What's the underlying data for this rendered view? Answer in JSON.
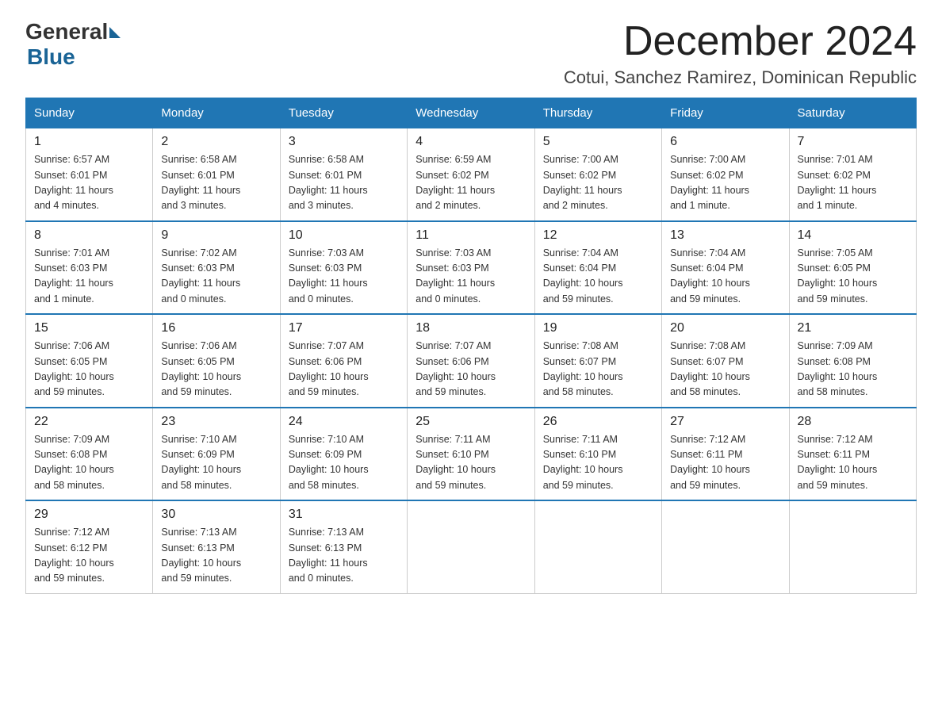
{
  "logo": {
    "general": "General",
    "blue": "Blue"
  },
  "header": {
    "month": "December 2024",
    "location": "Cotui, Sanchez Ramirez, Dominican Republic"
  },
  "days_of_week": [
    "Sunday",
    "Monday",
    "Tuesday",
    "Wednesday",
    "Thursday",
    "Friday",
    "Saturday"
  ],
  "weeks": [
    [
      {
        "day": "1",
        "sunrise": "6:57 AM",
        "sunset": "6:01 PM",
        "daylight": "11 hours and 4 minutes."
      },
      {
        "day": "2",
        "sunrise": "6:58 AM",
        "sunset": "6:01 PM",
        "daylight": "11 hours and 3 minutes."
      },
      {
        "day": "3",
        "sunrise": "6:58 AM",
        "sunset": "6:01 PM",
        "daylight": "11 hours and 3 minutes."
      },
      {
        "day": "4",
        "sunrise": "6:59 AM",
        "sunset": "6:02 PM",
        "daylight": "11 hours and 2 minutes."
      },
      {
        "day": "5",
        "sunrise": "7:00 AM",
        "sunset": "6:02 PM",
        "daylight": "11 hours and 2 minutes."
      },
      {
        "day": "6",
        "sunrise": "7:00 AM",
        "sunset": "6:02 PM",
        "daylight": "11 hours and 1 minute."
      },
      {
        "day": "7",
        "sunrise": "7:01 AM",
        "sunset": "6:02 PM",
        "daylight": "11 hours and 1 minute."
      }
    ],
    [
      {
        "day": "8",
        "sunrise": "7:01 AM",
        "sunset": "6:03 PM",
        "daylight": "11 hours and 1 minute."
      },
      {
        "day": "9",
        "sunrise": "7:02 AM",
        "sunset": "6:03 PM",
        "daylight": "11 hours and 0 minutes."
      },
      {
        "day": "10",
        "sunrise": "7:03 AM",
        "sunset": "6:03 PM",
        "daylight": "11 hours and 0 minutes."
      },
      {
        "day": "11",
        "sunrise": "7:03 AM",
        "sunset": "6:03 PM",
        "daylight": "11 hours and 0 minutes."
      },
      {
        "day": "12",
        "sunrise": "7:04 AM",
        "sunset": "6:04 PM",
        "daylight": "10 hours and 59 minutes."
      },
      {
        "day": "13",
        "sunrise": "7:04 AM",
        "sunset": "6:04 PM",
        "daylight": "10 hours and 59 minutes."
      },
      {
        "day": "14",
        "sunrise": "7:05 AM",
        "sunset": "6:05 PM",
        "daylight": "10 hours and 59 minutes."
      }
    ],
    [
      {
        "day": "15",
        "sunrise": "7:06 AM",
        "sunset": "6:05 PM",
        "daylight": "10 hours and 59 minutes."
      },
      {
        "day": "16",
        "sunrise": "7:06 AM",
        "sunset": "6:05 PM",
        "daylight": "10 hours and 59 minutes."
      },
      {
        "day": "17",
        "sunrise": "7:07 AM",
        "sunset": "6:06 PM",
        "daylight": "10 hours and 59 minutes."
      },
      {
        "day": "18",
        "sunrise": "7:07 AM",
        "sunset": "6:06 PM",
        "daylight": "10 hours and 59 minutes."
      },
      {
        "day": "19",
        "sunrise": "7:08 AM",
        "sunset": "6:07 PM",
        "daylight": "10 hours and 58 minutes."
      },
      {
        "day": "20",
        "sunrise": "7:08 AM",
        "sunset": "6:07 PM",
        "daylight": "10 hours and 58 minutes."
      },
      {
        "day": "21",
        "sunrise": "7:09 AM",
        "sunset": "6:08 PM",
        "daylight": "10 hours and 58 minutes."
      }
    ],
    [
      {
        "day": "22",
        "sunrise": "7:09 AM",
        "sunset": "6:08 PM",
        "daylight": "10 hours and 58 minutes."
      },
      {
        "day": "23",
        "sunrise": "7:10 AM",
        "sunset": "6:09 PM",
        "daylight": "10 hours and 58 minutes."
      },
      {
        "day": "24",
        "sunrise": "7:10 AM",
        "sunset": "6:09 PM",
        "daylight": "10 hours and 58 minutes."
      },
      {
        "day": "25",
        "sunrise": "7:11 AM",
        "sunset": "6:10 PM",
        "daylight": "10 hours and 59 minutes."
      },
      {
        "day": "26",
        "sunrise": "7:11 AM",
        "sunset": "6:10 PM",
        "daylight": "10 hours and 59 minutes."
      },
      {
        "day": "27",
        "sunrise": "7:12 AM",
        "sunset": "6:11 PM",
        "daylight": "10 hours and 59 minutes."
      },
      {
        "day": "28",
        "sunrise": "7:12 AM",
        "sunset": "6:11 PM",
        "daylight": "10 hours and 59 minutes."
      }
    ],
    [
      {
        "day": "29",
        "sunrise": "7:12 AM",
        "sunset": "6:12 PM",
        "daylight": "10 hours and 59 minutes."
      },
      {
        "day": "30",
        "sunrise": "7:13 AM",
        "sunset": "6:13 PM",
        "daylight": "10 hours and 59 minutes."
      },
      {
        "day": "31",
        "sunrise": "7:13 AM",
        "sunset": "6:13 PM",
        "daylight": "11 hours and 0 minutes."
      },
      null,
      null,
      null,
      null
    ]
  ]
}
